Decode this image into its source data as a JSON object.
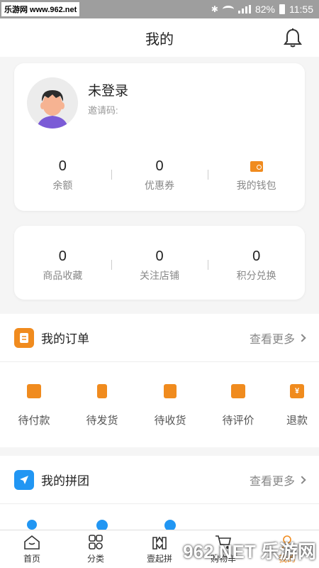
{
  "status_bar": {
    "watermark": "乐游网 www.962.net",
    "battery": "82%",
    "time": "11:55"
  },
  "header": {
    "title": "我的"
  },
  "profile": {
    "name": "未登录",
    "invite_label": "邀请码:"
  },
  "stats": [
    {
      "value": "0",
      "label": "余额"
    },
    {
      "value": "0",
      "label": "优惠券"
    },
    {
      "value": "",
      "label": "我的钱包",
      "icon": "wallet-icon"
    }
  ],
  "favorites": [
    {
      "value": "0",
      "label": "商品收藏"
    },
    {
      "value": "0",
      "label": "关注店铺"
    },
    {
      "value": "0",
      "label": "积分兑换"
    }
  ],
  "orders": {
    "title": "我的订单",
    "more": "查看更多",
    "items": [
      {
        "label": "待付款",
        "icon": "wallet-icon"
      },
      {
        "label": "待发货",
        "icon": "hourglass-icon"
      },
      {
        "label": "待收货",
        "icon": "package-icon"
      },
      {
        "label": "待评价",
        "icon": "comment-icon"
      },
      {
        "label": "退款",
        "icon": "yen-icon",
        "glyph": "¥"
      }
    ]
  },
  "group": {
    "title": "我的拼团",
    "more": "查看更多"
  },
  "tabbar": [
    {
      "label": "首页",
      "icon": "home-icon"
    },
    {
      "label": "分类",
      "icon": "category-icon"
    },
    {
      "label": "壹起拼",
      "icon": "group-buy-icon"
    },
    {
      "label": "购物车",
      "icon": "cart-icon"
    },
    {
      "label": "我的",
      "icon": "profile-icon"
    }
  ],
  "watermark_logo": "962.NET 乐游网",
  "colors": {
    "accent": "#f08b1e",
    "group_icon": "#2196f3"
  }
}
